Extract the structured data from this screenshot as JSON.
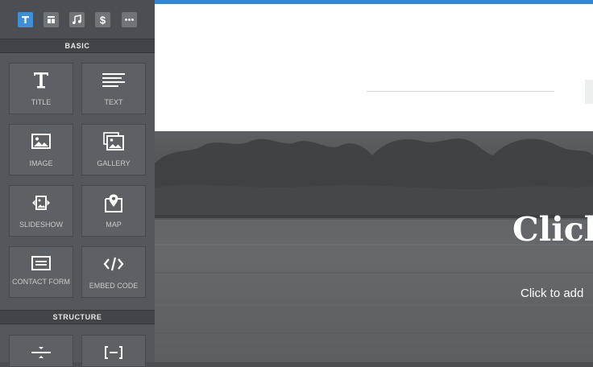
{
  "sidebar": {
    "tabs": [
      {
        "name": "title-tab-icon",
        "active": true
      },
      {
        "name": "layout-tab-icon",
        "active": false
      },
      {
        "name": "music-tab-icon",
        "active": false
      },
      {
        "name": "dollar-tab-icon",
        "active": false
      },
      {
        "name": "more-tab-icon",
        "active": false
      }
    ],
    "sections": {
      "basic": "BASIC",
      "structure": "STRUCTURE"
    },
    "basic_items": [
      {
        "label": "TITLE",
        "icon": "title-icon"
      },
      {
        "label": "TEXT",
        "icon": "text-icon"
      },
      {
        "label": "IMAGE",
        "icon": "image-icon"
      },
      {
        "label": "GALLERY",
        "icon": "gallery-icon"
      },
      {
        "label": "SLIDESHOW",
        "icon": "slideshow-icon"
      },
      {
        "label": "MAP",
        "icon": "map-icon"
      },
      {
        "label": "CONTACT FORM",
        "icon": "contact-form-icon"
      },
      {
        "label": "EMBED CODE",
        "icon": "embed-code-icon"
      }
    ],
    "structure_items": [
      {
        "icon": "divider-icon"
      },
      {
        "icon": "spacer-icon"
      }
    ]
  },
  "canvas": {
    "banner_title": "Click",
    "banner_subtitle": "Click to add"
  },
  "colors": {
    "accent": "#2f86d9",
    "sidebar_bg": "#54585c",
    "tile_bg": "#5d6165"
  }
}
